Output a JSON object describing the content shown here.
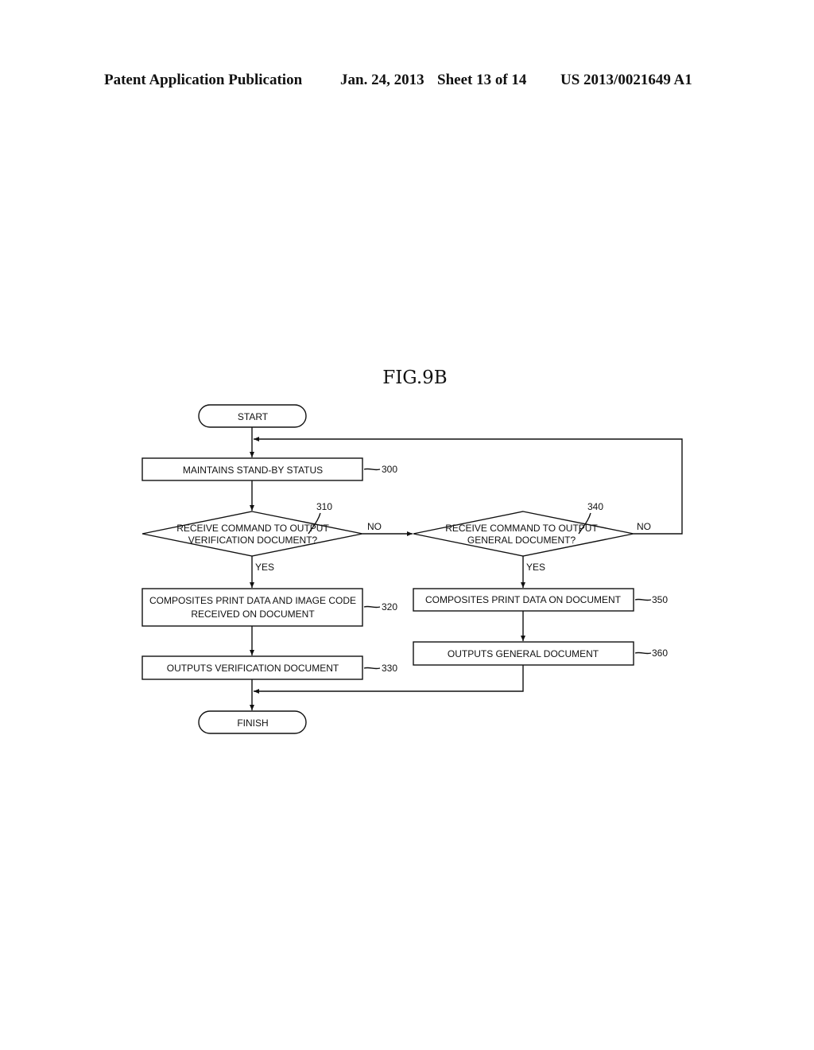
{
  "header": {
    "publication": "Patent Application Publication",
    "date": "Jan. 24, 2013",
    "sheet": "Sheet 13 of 14",
    "number": "US 2013/0021649 A1"
  },
  "figure": {
    "title": "FIG.9B",
    "nodes": {
      "start": {
        "label": "START"
      },
      "step300": {
        "line1": "MAINTAINS STAND-BY STATUS",
        "ref": "300"
      },
      "step310": {
        "line1": "RECEIVE COMMAND TO OUTPUT",
        "line2": "VERIFICATION DOCUMENT?",
        "ref": "310"
      },
      "step340": {
        "line1": "RECEIVE COMMAND TO OUTPUT",
        "line2": "GENERAL DOCUMENT?",
        "ref": "340"
      },
      "step320": {
        "line1": "COMPOSITES PRINT DATA AND IMAGE CODE",
        "line2": "RECEIVED ON DOCUMENT",
        "ref": "320"
      },
      "step330": {
        "line1": "OUTPUTS VERIFICATION DOCUMENT",
        "ref": "330"
      },
      "step350": {
        "line1": "COMPOSITES PRINT DATA ON DOCUMENT",
        "ref": "350"
      },
      "step360": {
        "line1": "OUTPUTS GENERAL DOCUMENT",
        "ref": "360"
      },
      "finish": {
        "label": "FINISH"
      }
    },
    "edge_labels": {
      "no_310": "NO",
      "yes_310": "YES",
      "no_340": "NO",
      "yes_340": "YES"
    }
  }
}
